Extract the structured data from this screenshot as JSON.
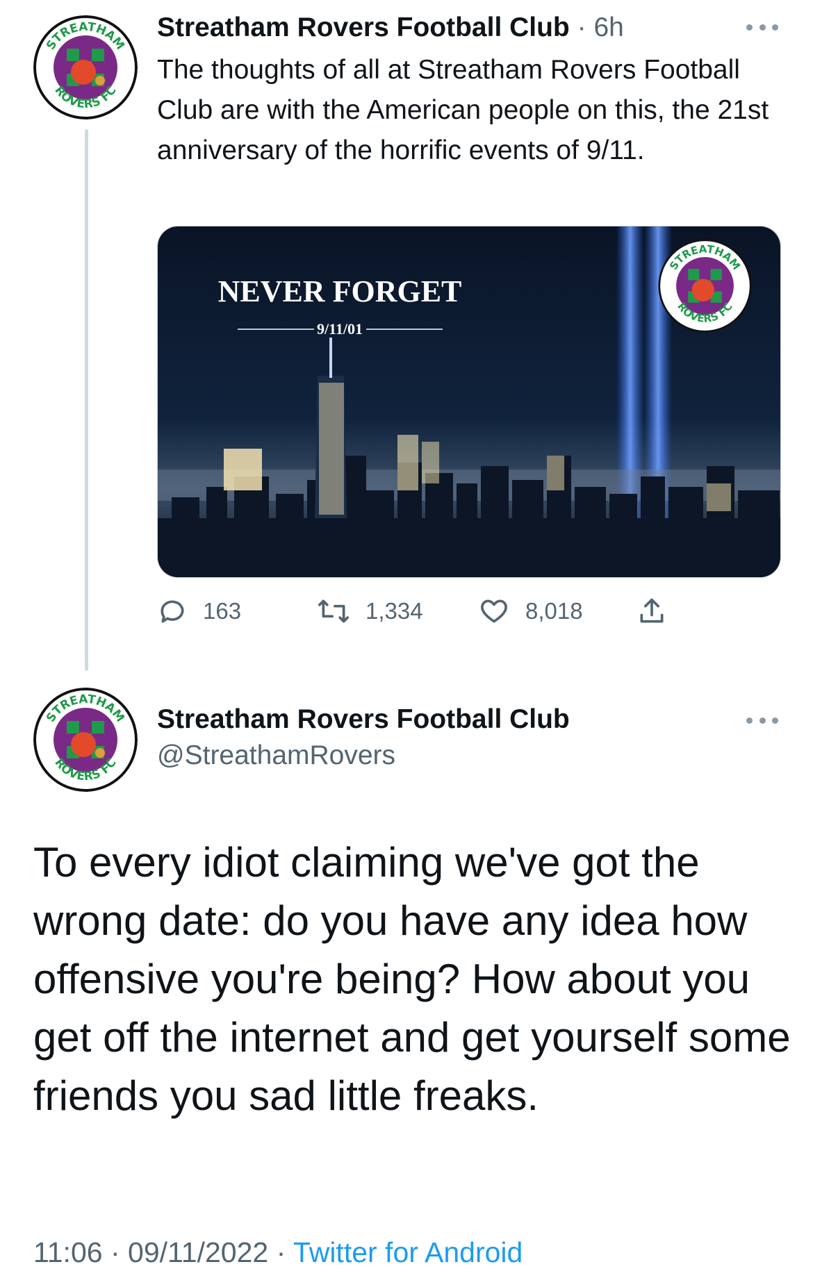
{
  "tweet1": {
    "author_name": "Streatham Rovers Football Club",
    "separator": "·",
    "time_ago": "6h",
    "text": "The thoughts of all at Streatham Rovers Football Club are with the American people on this, the 21st anniversary of the horrific events of 9/11.",
    "media": {
      "headline": "NEVER FORGET",
      "date_label": "9/11/01"
    },
    "actions": {
      "replies": "163",
      "retweets": "1,334",
      "likes": "8,018"
    }
  },
  "tweet2": {
    "author_name": "Streatham Rovers Football Club",
    "handle": "@StreathamRovers",
    "text": "To every idiot claiming we've got the wrong date: do you have any idea how offensive you're being? How about you get off the internet and get yourself some friends you sad little freaks.",
    "footer": {
      "time": "11:06",
      "sep1": "·",
      "date": "09/11/2022",
      "sep2": "·",
      "source": "Twitter for Android"
    }
  },
  "logo_text": {
    "top": "STREATHAM",
    "bottom": "ROVERS FC"
  },
  "colors": {
    "text": "#0f1419",
    "secondary": "#536471",
    "link": "#1d9bf0",
    "logo_green": "#1f9a4a",
    "logo_purple": "#7a2a86"
  },
  "icons": [
    "reply-icon",
    "retweet-icon",
    "like-icon",
    "share-icon",
    "more-icon"
  ]
}
